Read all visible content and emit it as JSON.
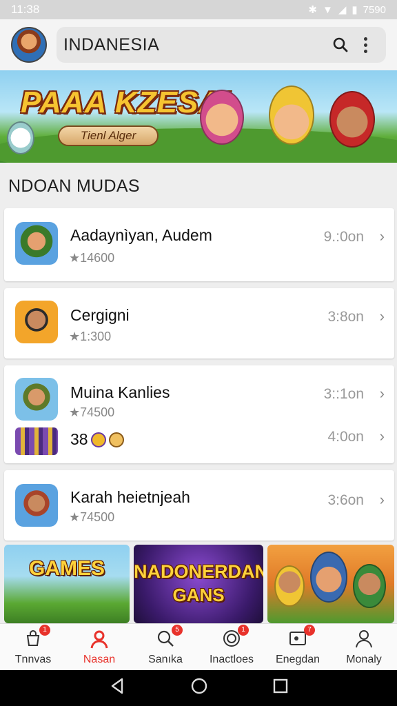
{
  "status": {
    "time": "11:38",
    "battery": "7590"
  },
  "header": {
    "title": "INDANESIA"
  },
  "banner": {
    "title": "PAAA KZESA!",
    "button": "Tienl Alger"
  },
  "section": {
    "title": "NDOAN MUDAS"
  },
  "games": [
    {
      "name": "Aadaynìyan, Audem",
      "rating": "★14600",
      "time": "9.:0on"
    },
    {
      "name": "Cergigni",
      "rating": "★1:300",
      "time": "3:8on"
    },
    {
      "name": "Muina Kanlies",
      "rating": "★74500",
      "time": "3::1on"
    },
    {
      "name": "38",
      "rating": "",
      "time": "4:0on"
    },
    {
      "name": "Karah heietnjeah",
      "rating": "★74500",
      "time": "3:6on"
    }
  ],
  "tiles": [
    {
      "label": "GAMES"
    },
    {
      "label": "NADONERDAN",
      "sub": "GANS"
    },
    {
      "label": ""
    }
  ],
  "nav": [
    {
      "label": "Tnnvas",
      "icon": "shopping-bag-icon",
      "badge": "1"
    },
    {
      "label": "Nasan",
      "icon": "person-icon",
      "badge": ""
    },
    {
      "label": "Sanıka",
      "icon": "search-icon",
      "badge": "5"
    },
    {
      "label": "Inactloes",
      "icon": "activity-icon",
      "badge": "1"
    },
    {
      "label": "Enegdan",
      "icon": "game-card-icon",
      "badge": "7"
    },
    {
      "label": "Monaly",
      "icon": "profile-icon",
      "badge": ""
    }
  ],
  "colors": {
    "accent": "#e8322b",
    "statusbar": "#d6d6d6"
  }
}
